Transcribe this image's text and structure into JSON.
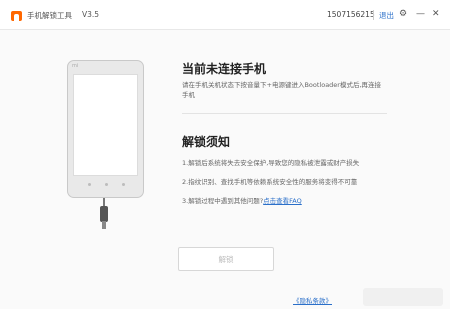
{
  "titlebar": {
    "app_title": "手机解锁工具",
    "version": "V3.5",
    "account_id": "1507156215",
    "logout_label": "退出",
    "icons": [
      "gear-icon",
      "minimize-icon",
      "close-icon"
    ]
  },
  "phone": {
    "brand": "mi"
  },
  "main": {
    "title": "当前未连接手机",
    "instruction": "请在手机关机状态下按音量下+电源键进入Bootloader模式后,再连接手机",
    "notice_title": "解锁须知",
    "notices": [
      "1.解锁后系统将失去安全保护,导致您的隐私被泄露或财产损失",
      "2.指纹识别、查找手机等依赖系统安全性的服务将变得不可靠",
      "3.解锁过程中遇到其他问题?"
    ],
    "faq_link": "点击查看FAQ",
    "unlock_button": "解锁"
  },
  "footer": {
    "privacy_link": "《隐私条款》"
  },
  "colors": {
    "brand": "#ff6700",
    "link": "#2a6fc9",
    "background": "#fafafa"
  }
}
